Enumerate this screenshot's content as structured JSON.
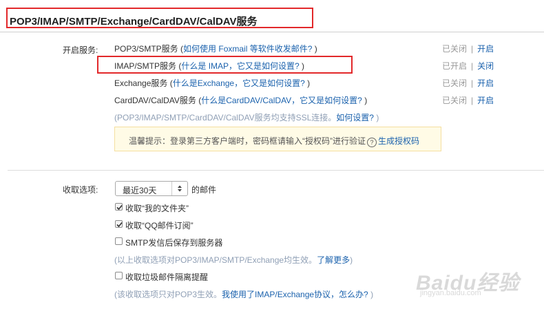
{
  "header": {
    "title": "POP3/IMAP/SMTP/Exchange/CardDAV/CalDAV服务"
  },
  "services": {
    "label": "开启服务:",
    "items": [
      {
        "name": "POP3/SMTP服务",
        "open_paren": " (",
        "help": "如何使用 Foxmail 等软件收发邮件?",
        "close_paren": " )",
        "status": "已关闭",
        "action": "开启"
      },
      {
        "name": "IMAP/SMTP服务",
        "open_paren": " (",
        "help": "什么是 IMAP，它又是如何设置?",
        "close_paren": " )",
        "status": "已开启",
        "action": "关闭"
      },
      {
        "name": "Exchange服务",
        "open_paren": " (",
        "help": "什么是Exchange，它又是如何设置?",
        "close_paren": " )",
        "status": "已关闭",
        "action": "开启"
      },
      {
        "name": "CardDAV/CalDAV服务",
        "open_paren": " (",
        "help": "什么是CardDAV/CalDAV，它又是如何设置?",
        "close_paren": " )",
        "status": "已关闭",
        "action": "开启"
      }
    ],
    "separator": "|",
    "ssl_note": "(POP3/IMAP/SMTP/CardDAV/CalDAV服务均支持SSL连接。",
    "ssl_link": "如何设置?",
    "ssl_close": " )",
    "tip_text": "温馨提示：登录第三方客户端时，密码框请输入“授权码”进行验证",
    "tip_icon": "?",
    "tip_link": "生成授权码"
  },
  "receive": {
    "label": "收取选项:",
    "select_value": "最近30天",
    "select_suffix": "的邮件",
    "options": [
      {
        "label": "收取“我的文件夹”",
        "checked": true
      },
      {
        "label": "收取“QQ邮件订阅”",
        "checked": true
      },
      {
        "label": "SMTP发信后保存到服务器",
        "checked": false
      }
    ],
    "note1": "(以上收取选项对POP3/IMAP/SMTP/Exchange均生效。",
    "note1_link": "了解更多",
    "note1_close": ")",
    "spam_label": "收取垃圾邮件隔离提醒",
    "spam_checked": false,
    "note2": "(该收取选项只对POP3生效。",
    "note2_link": "我使用了IMAP/Exchange协议，怎么办?",
    "note2_close": " )"
  },
  "watermark": {
    "brand": "Baidu经验",
    "url": "jingyan.baidu.com"
  }
}
